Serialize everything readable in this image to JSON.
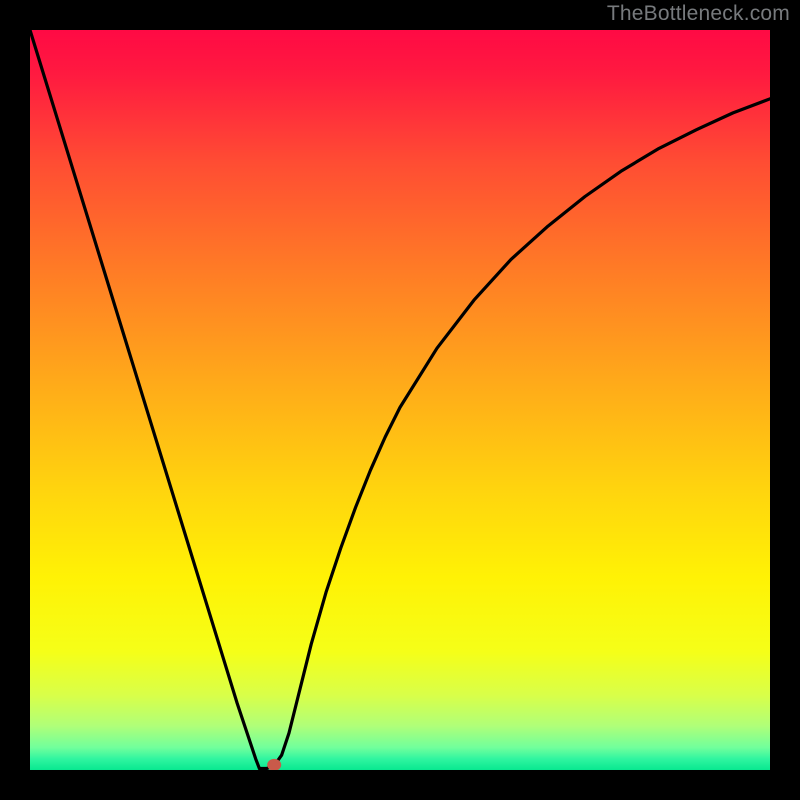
{
  "watermark": "TheBottleneck.com",
  "chart_data": {
    "type": "line",
    "title": "",
    "xlabel": "",
    "ylabel": "",
    "xlim": [
      0,
      100
    ],
    "ylim": [
      0,
      100
    ],
    "x": [
      0,
      2,
      4,
      6,
      8,
      10,
      12,
      14,
      16,
      18,
      20,
      22,
      24,
      26,
      28,
      30,
      30.5,
      31,
      32,
      33,
      34,
      35,
      36,
      37,
      38,
      40,
      42,
      44,
      46,
      48,
      50,
      55,
      60,
      65,
      70,
      75,
      80,
      85,
      90,
      95,
      100
    ],
    "values": [
      100,
      93.5,
      87,
      80.5,
      74,
      67.5,
      61,
      54.5,
      48,
      41.5,
      35,
      28.5,
      22,
      15.5,
      9,
      3,
      1.5,
      0.2,
      0.2,
      0.6,
      2,
      5,
      9,
      13,
      17,
      24,
      30,
      35.5,
      40.5,
      45,
      49,
      57,
      63.5,
      69,
      73.5,
      77.5,
      81,
      84,
      86.5,
      88.8,
      90.7
    ],
    "marker": {
      "x": 33,
      "y": 0.7
    },
    "background_gradient": {
      "stops": [
        {
          "offset": 0.0,
          "color": "#ff0a44"
        },
        {
          "offset": 0.06,
          "color": "#ff1a40"
        },
        {
          "offset": 0.18,
          "color": "#ff4d33"
        },
        {
          "offset": 0.32,
          "color": "#ff7a26"
        },
        {
          "offset": 0.47,
          "color": "#ffa81a"
        },
        {
          "offset": 0.62,
          "color": "#ffd40e"
        },
        {
          "offset": 0.74,
          "color": "#fff205"
        },
        {
          "offset": 0.84,
          "color": "#f5ff18"
        },
        {
          "offset": 0.9,
          "color": "#d8ff4a"
        },
        {
          "offset": 0.94,
          "color": "#b0ff78"
        },
        {
          "offset": 0.97,
          "color": "#70ff9c"
        },
        {
          "offset": 0.985,
          "color": "#30f5a0"
        },
        {
          "offset": 1.0,
          "color": "#08e890"
        }
      ]
    }
  }
}
